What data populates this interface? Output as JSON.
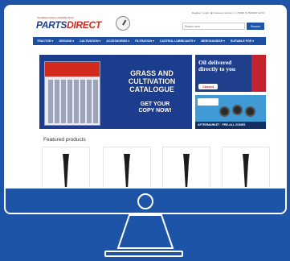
{
  "site": {
    "brand": {
      "part1": "PARTS",
      "part2": "DIRECT",
      "tagline": "INTERNATIONAL DISTRIBUTION"
    },
    "toplinks": "Register | Login | ◉ Customer service | ☐ ITEMS IN BASKET £0.00",
    "search": {
      "placeholder": "Search here",
      "button_label": "Search"
    },
    "nav": [
      {
        "label": "TRACTOR ▾"
      },
      {
        "label": "GROUND ▾"
      },
      {
        "label": "CULTIVATION ▾"
      },
      {
        "label": "ACCESSORIES ▾"
      },
      {
        "label": "FILTRATION ▾"
      },
      {
        "label": "CASTROL LUBRICANTS ▾"
      },
      {
        "label": "MERCHANDISE ▾"
      },
      {
        "label": "SUITABLE FOR ▾"
      }
    ],
    "hero": {
      "title_line1": "GRASS AND",
      "title_line2": "CULTIVATION",
      "title_line3": "CATALOGUE",
      "cta_line1": "GET YOUR",
      "cta_line2": "COPY NOW!"
    },
    "oil_banner": {
      "text_line1": "Oil delivered",
      "text_line2": "directly to you",
      "brand": "Castrol"
    },
    "aftermarket_banner": {
      "label": "AFTERMARKET · PRE-ALL ZONES"
    },
    "featured_heading": "Featured products",
    "colors": {
      "navy": "#1d3f8f",
      "red": "#d42a1e",
      "page_blue": "#1d54a8"
    }
  }
}
